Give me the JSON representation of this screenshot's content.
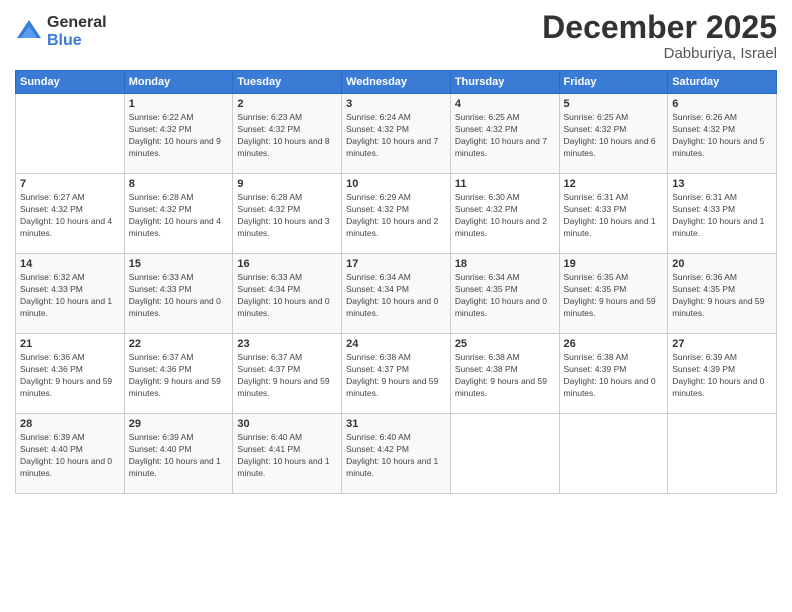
{
  "logo": {
    "general": "General",
    "blue": "Blue"
  },
  "title": "December 2025",
  "location": "Dabburiya, Israel",
  "days_of_week": [
    "Sunday",
    "Monday",
    "Tuesday",
    "Wednesday",
    "Thursday",
    "Friday",
    "Saturday"
  ],
  "weeks": [
    [
      {
        "day": "",
        "sunrise": "",
        "sunset": "",
        "daylight": ""
      },
      {
        "day": "1",
        "sunrise": "Sunrise: 6:22 AM",
        "sunset": "Sunset: 4:32 PM",
        "daylight": "Daylight: 10 hours and 9 minutes."
      },
      {
        "day": "2",
        "sunrise": "Sunrise: 6:23 AM",
        "sunset": "Sunset: 4:32 PM",
        "daylight": "Daylight: 10 hours and 8 minutes."
      },
      {
        "day": "3",
        "sunrise": "Sunrise: 6:24 AM",
        "sunset": "Sunset: 4:32 PM",
        "daylight": "Daylight: 10 hours and 7 minutes."
      },
      {
        "day": "4",
        "sunrise": "Sunrise: 6:25 AM",
        "sunset": "Sunset: 4:32 PM",
        "daylight": "Daylight: 10 hours and 7 minutes."
      },
      {
        "day": "5",
        "sunrise": "Sunrise: 6:25 AM",
        "sunset": "Sunset: 4:32 PM",
        "daylight": "Daylight: 10 hours and 6 minutes."
      },
      {
        "day": "6",
        "sunrise": "Sunrise: 6:26 AM",
        "sunset": "Sunset: 4:32 PM",
        "daylight": "Daylight: 10 hours and 5 minutes."
      }
    ],
    [
      {
        "day": "7",
        "sunrise": "Sunrise: 6:27 AM",
        "sunset": "Sunset: 4:32 PM",
        "daylight": "Daylight: 10 hours and 4 minutes."
      },
      {
        "day": "8",
        "sunrise": "Sunrise: 6:28 AM",
        "sunset": "Sunset: 4:32 PM",
        "daylight": "Daylight: 10 hours and 4 minutes."
      },
      {
        "day": "9",
        "sunrise": "Sunrise: 6:28 AM",
        "sunset": "Sunset: 4:32 PM",
        "daylight": "Daylight: 10 hours and 3 minutes."
      },
      {
        "day": "10",
        "sunrise": "Sunrise: 6:29 AM",
        "sunset": "Sunset: 4:32 PM",
        "daylight": "Daylight: 10 hours and 2 minutes."
      },
      {
        "day": "11",
        "sunrise": "Sunrise: 6:30 AM",
        "sunset": "Sunset: 4:32 PM",
        "daylight": "Daylight: 10 hours and 2 minutes."
      },
      {
        "day": "12",
        "sunrise": "Sunrise: 6:31 AM",
        "sunset": "Sunset: 4:33 PM",
        "daylight": "Daylight: 10 hours and 1 minute."
      },
      {
        "day": "13",
        "sunrise": "Sunrise: 6:31 AM",
        "sunset": "Sunset: 4:33 PM",
        "daylight": "Daylight: 10 hours and 1 minute."
      }
    ],
    [
      {
        "day": "14",
        "sunrise": "Sunrise: 6:32 AM",
        "sunset": "Sunset: 4:33 PM",
        "daylight": "Daylight: 10 hours and 1 minute."
      },
      {
        "day": "15",
        "sunrise": "Sunrise: 6:33 AM",
        "sunset": "Sunset: 4:33 PM",
        "daylight": "Daylight: 10 hours and 0 minutes."
      },
      {
        "day": "16",
        "sunrise": "Sunrise: 6:33 AM",
        "sunset": "Sunset: 4:34 PM",
        "daylight": "Daylight: 10 hours and 0 minutes."
      },
      {
        "day": "17",
        "sunrise": "Sunrise: 6:34 AM",
        "sunset": "Sunset: 4:34 PM",
        "daylight": "Daylight: 10 hours and 0 minutes."
      },
      {
        "day": "18",
        "sunrise": "Sunrise: 6:34 AM",
        "sunset": "Sunset: 4:35 PM",
        "daylight": "Daylight: 10 hours and 0 minutes."
      },
      {
        "day": "19",
        "sunrise": "Sunrise: 6:35 AM",
        "sunset": "Sunset: 4:35 PM",
        "daylight": "Daylight: 9 hours and 59 minutes."
      },
      {
        "day": "20",
        "sunrise": "Sunrise: 6:36 AM",
        "sunset": "Sunset: 4:35 PM",
        "daylight": "Daylight: 9 hours and 59 minutes."
      }
    ],
    [
      {
        "day": "21",
        "sunrise": "Sunrise: 6:36 AM",
        "sunset": "Sunset: 4:36 PM",
        "daylight": "Daylight: 9 hours and 59 minutes."
      },
      {
        "day": "22",
        "sunrise": "Sunrise: 6:37 AM",
        "sunset": "Sunset: 4:36 PM",
        "daylight": "Daylight: 9 hours and 59 minutes."
      },
      {
        "day": "23",
        "sunrise": "Sunrise: 6:37 AM",
        "sunset": "Sunset: 4:37 PM",
        "daylight": "Daylight: 9 hours and 59 minutes."
      },
      {
        "day": "24",
        "sunrise": "Sunrise: 6:38 AM",
        "sunset": "Sunset: 4:37 PM",
        "daylight": "Daylight: 9 hours and 59 minutes."
      },
      {
        "day": "25",
        "sunrise": "Sunrise: 6:38 AM",
        "sunset": "Sunset: 4:38 PM",
        "daylight": "Daylight: 9 hours and 59 minutes."
      },
      {
        "day": "26",
        "sunrise": "Sunrise: 6:38 AM",
        "sunset": "Sunset: 4:39 PM",
        "daylight": "Daylight: 10 hours and 0 minutes."
      },
      {
        "day": "27",
        "sunrise": "Sunrise: 6:39 AM",
        "sunset": "Sunset: 4:39 PM",
        "daylight": "Daylight: 10 hours and 0 minutes."
      }
    ],
    [
      {
        "day": "28",
        "sunrise": "Sunrise: 6:39 AM",
        "sunset": "Sunset: 4:40 PM",
        "daylight": "Daylight: 10 hours and 0 minutes."
      },
      {
        "day": "29",
        "sunrise": "Sunrise: 6:39 AM",
        "sunset": "Sunset: 4:40 PM",
        "daylight": "Daylight: 10 hours and 1 minute."
      },
      {
        "day": "30",
        "sunrise": "Sunrise: 6:40 AM",
        "sunset": "Sunset: 4:41 PM",
        "daylight": "Daylight: 10 hours and 1 minute."
      },
      {
        "day": "31",
        "sunrise": "Sunrise: 6:40 AM",
        "sunset": "Sunset: 4:42 PM",
        "daylight": "Daylight: 10 hours and 1 minute."
      },
      {
        "day": "",
        "sunrise": "",
        "sunset": "",
        "daylight": ""
      },
      {
        "day": "",
        "sunrise": "",
        "sunset": "",
        "daylight": ""
      },
      {
        "day": "",
        "sunrise": "",
        "sunset": "",
        "daylight": ""
      }
    ]
  ]
}
